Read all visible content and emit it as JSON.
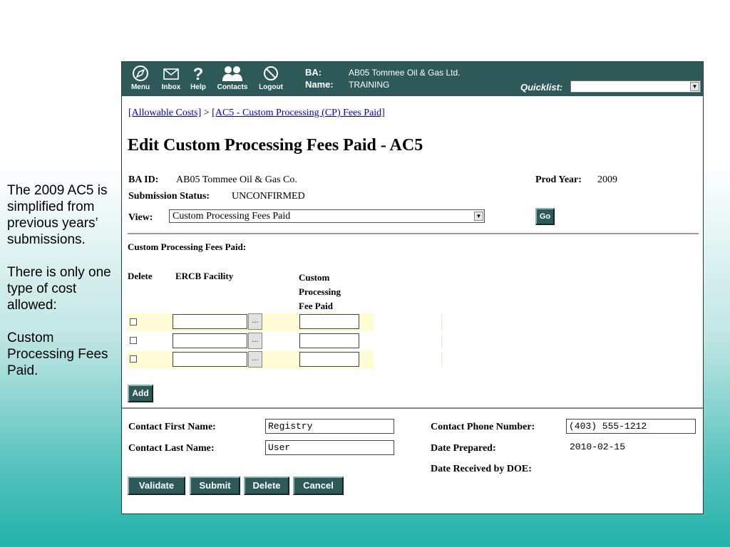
{
  "notes": [
    "The 2009 AC5 is simplified from previous years’ submissions.",
    "There is only one type of cost allowed:",
    "Custom Processing Fees Paid."
  ],
  "nav": {
    "menu": "Menu",
    "inbox": "Inbox",
    "help": "Help",
    "contacts": "Contacts",
    "logout": "Logout"
  },
  "header": {
    "ba_label": "BA:",
    "ba_value": "AB05 Tommee Oil & Gas Ltd.",
    "name_label": "Name:",
    "name_value": "TRAINING",
    "quicklist_label": "Quicklist:",
    "quicklist_value": ""
  },
  "breadcrumb": {
    "item1": "[Allowable Costs]",
    "sep": " > ",
    "item2": "[AC5 - Custom Processing (CP) Fees Paid]"
  },
  "page_title": "Edit Custom Processing Fees Paid - AC5",
  "info": {
    "ba_id_label": "BA ID:",
    "ba_id_value": "AB05 Tommee Oil & Gas Co.",
    "prod_year_label": "Prod Year:",
    "prod_year_value": "2009",
    "submission_status_label": "Submission Status:",
    "submission_status_value": "UNCONFIRMED",
    "view_label": "View:",
    "view_value": "Custom Processing Fees Paid",
    "go_label": "Go"
  },
  "section_title": "Custom  Processing Fees Paid:",
  "table": {
    "col_delete": "Delete",
    "col_facility": "ERCB Facility",
    "col_fee_line1": "Custom",
    "col_fee_line2": "Processing",
    "col_fee_line3": "Fee Paid",
    "ellipsis": "...",
    "rows": [
      {
        "delete": false,
        "facility": "",
        "fee": ""
      },
      {
        "delete": false,
        "facility": "",
        "fee": ""
      },
      {
        "delete": false,
        "facility": "",
        "fee": ""
      }
    ]
  },
  "add_label": "Add",
  "contact": {
    "first_name_label": "Contact First Name:",
    "first_name_value": "Registry",
    "last_name_label": "Contact Last Name:",
    "last_name_value": "User",
    "phone_label": "Contact Phone Number:",
    "phone_value": "(403) 555-1212",
    "date_prepared_label": "Date Prepared:",
    "date_prepared_value": "2010-02-15",
    "date_received_label": "Date Received by DOE:",
    "date_received_value": ""
  },
  "actions": {
    "validate": "Validate",
    "submit": "Submit",
    "delete": "Delete",
    "cancel": "Cancel"
  },
  "colors": {
    "header_bg": "#2d5a58",
    "row_highlight": "#fffbd3",
    "link": "#0000cc"
  }
}
